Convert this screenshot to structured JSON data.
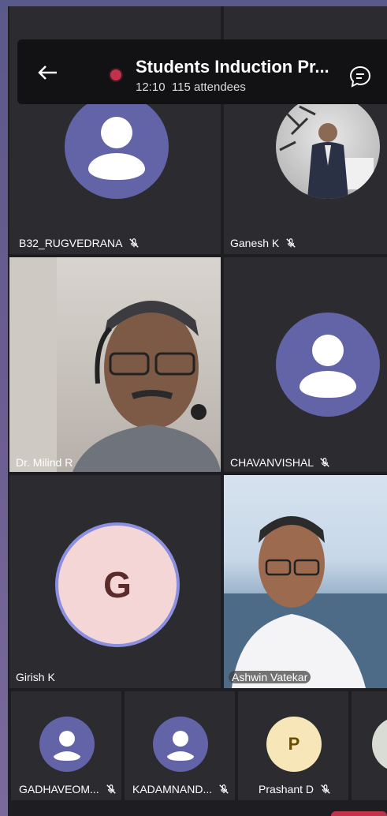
{
  "header": {
    "title": "Students Induction Pr...",
    "time": "12:10",
    "attendees": "115 attendees"
  },
  "participants": [
    {
      "name": "B32_RUGVEDRANA",
      "muted": true,
      "type": "avatar"
    },
    {
      "name": "Ganesh K",
      "muted": true,
      "type": "video"
    },
    {
      "name": "Dr. Milind R",
      "muted": false,
      "type": "video"
    },
    {
      "name": "CHAVANVISHAL",
      "muted": true,
      "type": "avatar"
    },
    {
      "name": "Girish K",
      "muted": false,
      "type": "initial",
      "initial": "G"
    },
    {
      "name": "Ashwin Vatekar",
      "muted": false,
      "type": "video"
    }
  ],
  "strip": [
    {
      "name": "GADHAVEOM...",
      "muted": true
    },
    {
      "name": "KADAMNAND...",
      "muted": true
    },
    {
      "name": "Prashant D",
      "muted": true,
      "initial": "P"
    }
  ],
  "colors": {
    "avatar_purple": "#6264a7",
    "record_red": "#c4314b",
    "tile_bg": "#2b2b30"
  }
}
